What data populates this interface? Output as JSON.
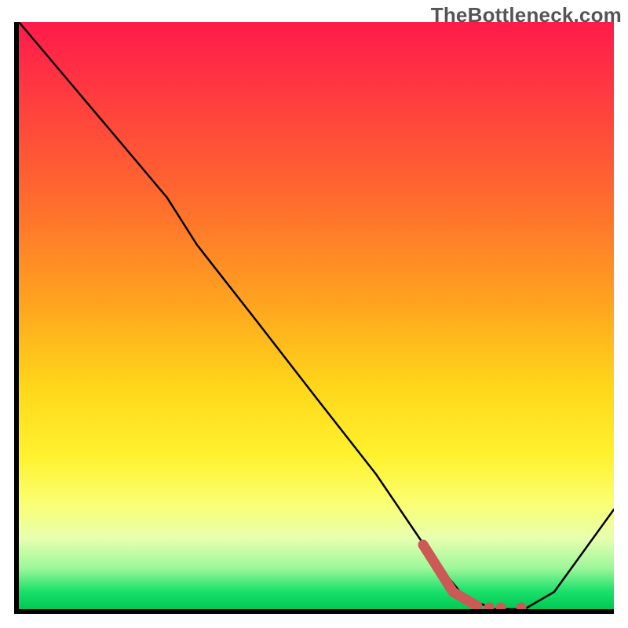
{
  "watermark": "TheBottleneck.com",
  "chart_data": {
    "type": "line",
    "title": "",
    "xlabel": "",
    "ylabel": "",
    "xlim": [
      0,
      100
    ],
    "ylim": [
      0,
      100
    ],
    "grid": false,
    "legend": false,
    "notes": "Background is a vertical heat gradient (red at top through green at bottom) indicating bottleneck severity. Black curve shows bottleneck magnitude vs. an unlabeled x-axis. Reddish thick segment marks a highlighted range near the minimum.",
    "series": [
      {
        "name": "bottleneck-curve",
        "x": [
          0,
          10,
          20,
          25,
          30,
          40,
          50,
          60,
          70,
          75,
          80,
          85,
          90,
          100
        ],
        "values": [
          100,
          88,
          76,
          70,
          62,
          49,
          36,
          23,
          8,
          2,
          0,
          0,
          3,
          17
        ]
      }
    ],
    "highlight": {
      "name": "optimal-range",
      "x_start": 68,
      "x_end": 86,
      "segment_points_x": [
        68,
        73,
        77
      ],
      "segment_points_y": [
        11,
        3,
        0.5
      ],
      "dots_x": [
        79,
        81,
        84.5
      ],
      "dots_y": [
        0.3,
        0.3,
        0.3
      ]
    },
    "colors": {
      "gradient": [
        "#ff1a4b",
        "#ff6a2e",
        "#ffd61a",
        "#fbff73",
        "#19e06a",
        "#00c853"
      ],
      "curve": "#000000",
      "highlight": "#cb5a56"
    }
  }
}
